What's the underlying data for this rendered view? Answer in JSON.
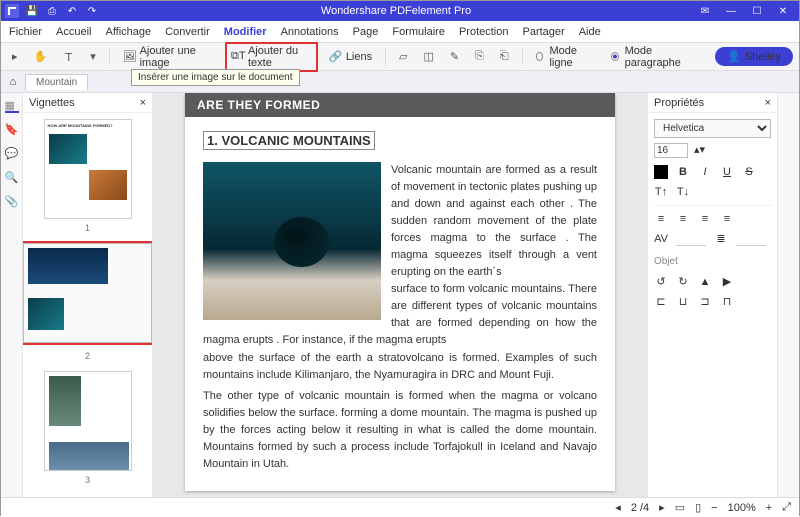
{
  "app": {
    "title": "Wondershare PDFelement Pro"
  },
  "menu": {
    "items": [
      "Fichier",
      "Accueil",
      "Affichage",
      "Convertir",
      "Modifier",
      "Annotations",
      "Page",
      "Formulaire",
      "Protection",
      "Partager",
      "Aide"
    ],
    "active": 4
  },
  "toolbar": {
    "addImage": "Ajouter une image",
    "addText": "Ajouter du texte",
    "links": "Liens",
    "modeLine": "Mode ligne",
    "modePara": "Mode paragraphe",
    "user": "Shelley",
    "tooltip": "Insérer une image sur le document"
  },
  "tab": {
    "name": "Mountain"
  },
  "thumbs": {
    "title": "Vignettes",
    "pages": [
      "1",
      "2",
      "3"
    ],
    "selected": 1,
    "miniTitle": "HOW ARE MOUNTAINS FORMED?"
  },
  "doc": {
    "banner": "ARE THEY FORMED",
    "h1": "1. VOLCANIC MOUNTAINS",
    "p1": "Volcanic mountain are formed as a result of movement in tectonic plates pushing up and down and against each other . The sudden random movement  of the plate forces magma  to the surface  . The magma squeezes itself through a vent erupting on the earth´s",
    "p2": "surface to form volcanic mountains. There are different types of volcanic mountains that are formed depending  on how the magma erupts . For instance, if the magma erupts",
    "p3": "above the surface of the earth a stratovolcano is formed. Examples of such mountains include Kilimanjaro, the Nyamuragira in DRC and Mount Fuji.",
    "p4": "The other type of volcanic mountain is formed when the magma or volcano solidifies below the surface. forming a dome mountain. The magma is pushed up by the forces acting below it resulting in what is called the dome mountain. Mountains formed by such a process include Torfajokull in Iceland and Navajo Mountain in Utah."
  },
  "props": {
    "title": "Propriétés",
    "font": "Helvetica",
    "size": "16",
    "objet": "Objet"
  },
  "status": {
    "page": "2 /4",
    "zoom": "100%"
  }
}
